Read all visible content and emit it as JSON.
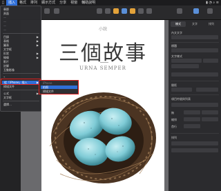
{
  "menubar": {
    "items": [
      "插入",
      "格式",
      "排列",
      "顯示方式",
      "分享",
      "視窗",
      "輔助說明"
    ],
    "active_index": 0
  },
  "document": {
    "small_title": "小說",
    "title": "三個故事",
    "author": "URNA SEMPER"
  },
  "insert_menu": {
    "items_top": [
      "章節",
      "頁面",
      "分欄",
      "",
      "",
      "",
      "",
      "",
      "",
      "",
      "",
      "",
      ""
    ],
    "items": [
      {
        "label": "章節",
        "dim": false
      },
      {
        "label": "頁面",
        "dim": false
      },
      {
        "label": "",
        "dim": true
      },
      {
        "label": "",
        "dim": true
      },
      {
        "label": "",
        "dim": true
      },
      {
        "label": "",
        "dim": true
      },
      {
        "label": "目錄",
        "dim": false,
        "arrow": true
      },
      {
        "label": "表格",
        "dim": false,
        "arrow": true
      },
      {
        "label": "圖表",
        "dim": false,
        "arrow": true
      },
      {
        "label": "文字框",
        "dim": false
      },
      {
        "label": "形狀",
        "dim": false,
        "arrow": true
      },
      {
        "label": "線條",
        "dim": false,
        "arrow": true
      },
      {
        "label": "影片",
        "dim": false
      },
      {
        "label": "註解",
        "dim": false
      },
      {
        "label": "互動影像",
        "dim": false
      }
    ],
    "device_item": "從「iPhone」插入",
    "scan_item": "掃描文件",
    "equation_item": "公式",
    "extra_item": "文字框",
    "choose_item": "選擇…"
  },
  "submenu": {
    "device": "iPhone",
    "photo": "拍照",
    "scan": "掃描文件"
  },
  "inspector": {
    "tabs": [
      "樣式",
      "文字",
      "排列"
    ],
    "section1": "內文文字",
    "title_style": "標題",
    "font": "文字樣式",
    "spacing_label": "間距",
    "bullets_label": "項目符號與列表",
    "options": [
      "無",
      "縮排",
      "首行"
    ],
    "layout_label": "排列"
  },
  "colors": {
    "accent": "#2f6fd8",
    "highlight_box": "#e02020",
    "egg": "#8ed3dc"
  }
}
